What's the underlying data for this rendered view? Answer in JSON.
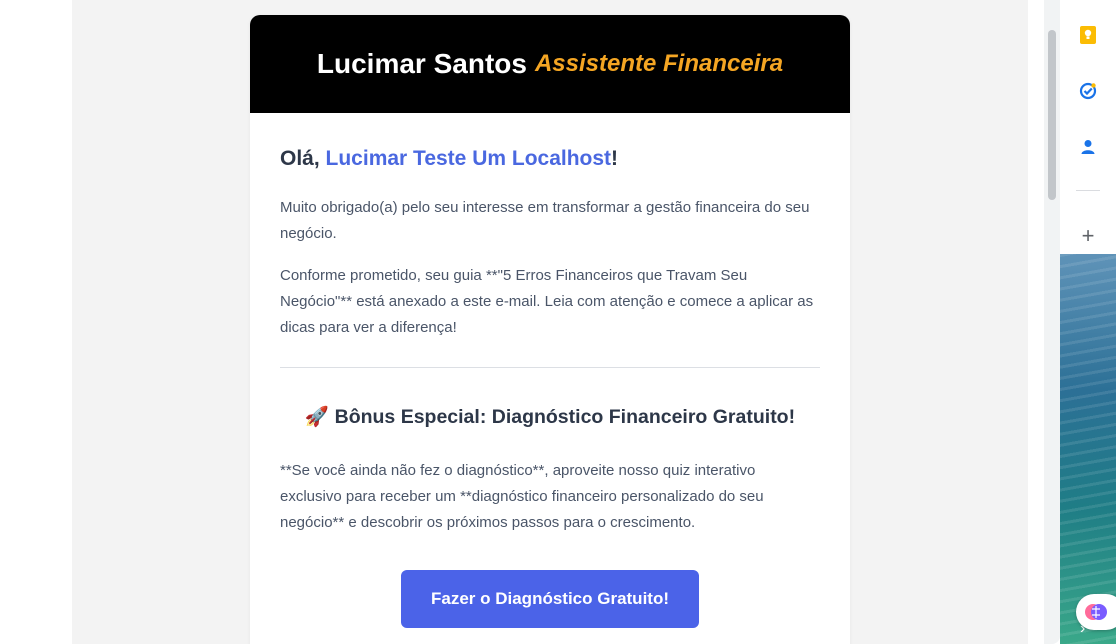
{
  "email": {
    "header": {
      "name": "Lucimar Santos",
      "role": "Assistente Financeira"
    },
    "greeting": {
      "prefix": "Olá, ",
      "lead_name": "Lucimar Teste Um Localhost",
      "suffix": "!"
    },
    "paragraphs": [
      "Muito obrigado(a) pelo seu interesse em transformar a gestão financeira do seu negócio.",
      "Conforme prometido, seu guia **\"5 Erros Financeiros que Travam Seu Negócio\"** está anexado a este e-mail. Leia com atenção e comece a aplicar as dicas para ver a diferença!"
    ],
    "bonus": {
      "emoji": "🚀",
      "title": "Bônus Especial: Diagnóstico Financeiro Gratuito!",
      "text": "**Se você ainda não fez o diagnóstico**, aproveite nosso quiz interativo exclusivo para receber um **diagnóstico financeiro personalizado do seu negócio** e descobrir os próximos passos para o crescimento."
    },
    "cta_label": "Fazer o Diagnóstico Gratuito!"
  },
  "side_panel": {
    "icons": [
      "keep-icon",
      "tasks-icon",
      "contacts-icon",
      "add-icon",
      "chevron-right-icon",
      "brain-extension-icon"
    ],
    "colors": {
      "keep": "#fbbc04",
      "tasks": "#1a73e8",
      "contacts": "#1a73e8"
    }
  },
  "colors": {
    "header_bg": "#000000",
    "role_accent": "#f5a623",
    "link_blue": "#4a68e0",
    "cta_bg": "#4b63e8"
  }
}
